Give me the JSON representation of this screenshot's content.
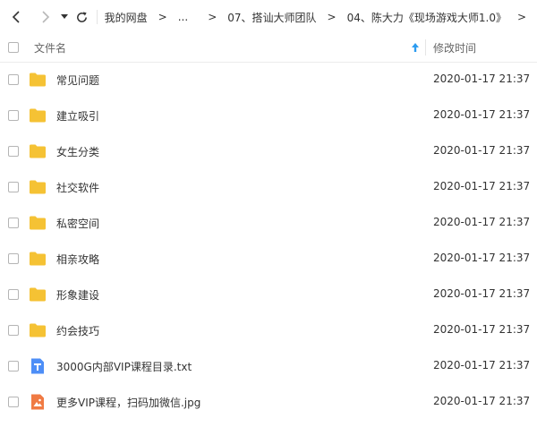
{
  "nav": {
    "breadcrumbs": [
      "我的网盘",
      "...",
      "07、搭讪大师团队",
      "04、陈大力《现场游戏大师1.0》"
    ],
    "separator": ">"
  },
  "columns": {
    "name": "文件名",
    "modified": "修改时间"
  },
  "files": [
    {
      "name": "常见问题",
      "type": "folder",
      "modified": "2020-01-17 21:37"
    },
    {
      "name": "建立吸引",
      "type": "folder",
      "modified": "2020-01-17 21:37"
    },
    {
      "name": "女生分类",
      "type": "folder",
      "modified": "2020-01-17 21:37"
    },
    {
      "name": "社交软件",
      "type": "folder",
      "modified": "2020-01-17 21:37"
    },
    {
      "name": "私密空间",
      "type": "folder",
      "modified": "2020-01-17 21:37"
    },
    {
      "name": "相亲攻略",
      "type": "folder",
      "modified": "2020-01-17 21:37"
    },
    {
      "name": "形象建设",
      "type": "folder",
      "modified": "2020-01-17 21:37"
    },
    {
      "name": "约会技巧",
      "type": "folder",
      "modified": "2020-01-17 21:37"
    },
    {
      "name": "3000G内部VIP课程目录.txt",
      "type": "txt",
      "modified": "2020-01-17 21:37"
    },
    {
      "name": "更多VIP课程，扫码加微信.jpg",
      "type": "image",
      "modified": "2020-01-17 21:37"
    }
  ],
  "colors": {
    "folder": "#f5c234",
    "txt": "#4d8ef7",
    "image": "#f07a43",
    "sort_arrow": "#2d9cf0"
  }
}
